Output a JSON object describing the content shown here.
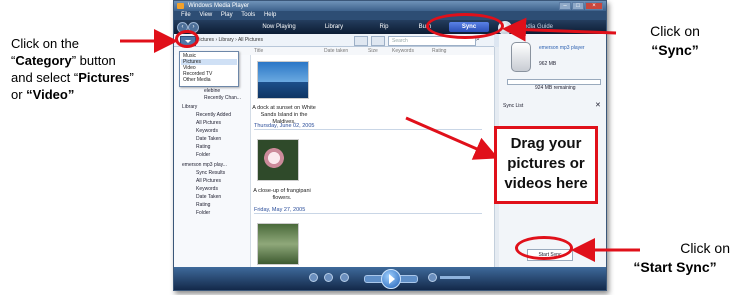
{
  "window": {
    "title": "Windows Media Player",
    "menu": [
      "File",
      "View",
      "Play",
      "Tools",
      "Help"
    ],
    "nav_tabs": [
      "Now Playing",
      "Library",
      "Rip",
      "Burn",
      "Sync"
    ],
    "media_guide_label": "Media Guide"
  },
  "toolbar": {
    "breadcrumb": "Pictures › Library › All Pictures",
    "search_placeholder": "Search"
  },
  "columns": [
    "Title",
    "Date taken",
    "Size",
    "Keywords",
    "Rating"
  ],
  "category_menu": [
    "Music",
    "Pictures",
    "Video",
    "Recorded TV",
    "Other Media"
  ],
  "tree": {
    "items": [
      "elebine",
      "Recently Chan...",
      "Library",
      "Recently Added",
      "All Pictures",
      "Keywords",
      "Date Taken",
      "Rating",
      "Folder",
      "emerson mp3 play...",
      "Sync Results",
      "All Pictures",
      "Keywords",
      "Date Taken",
      "Rating",
      "Folder"
    ]
  },
  "content": {
    "caption1": "A dock at sunset on White Sands Island in the Maldives.",
    "date1": "Thursday, June 02, 2005",
    "caption2": "A close-up of frangipani flowers.",
    "date2": "Friday, May 27, 2005"
  },
  "sync_pane": {
    "device_name": "emerson mp3 player",
    "capacity": "962 MB",
    "remaining": "924 MB remaining",
    "sync_list_label": "Sync List",
    "start_sync_label": "Start Sync"
  },
  "annotations": {
    "category_line1": "Click on the",
    "category_line2_bold": "Category",
    "category_line2_rest": "” button",
    "category_line3_pre": "and select “",
    "category_line3_bold": "Pictures",
    "category_line3_rest": "”",
    "category_line4_pre": "or ",
    "category_line4_bold": "“Video”",
    "sync_line1": "Click on",
    "sync_line2": "“Sync”",
    "drag_line1": "Drag your",
    "drag_line2": "pictures or",
    "drag_line3": "videos here",
    "start_line1": "Click on",
    "start_line2": "“Start Sync”"
  },
  "colors": {
    "highlight": "#e0101a",
    "sync_tab": "#2b4fb8",
    "window_border": "#3b5779"
  }
}
